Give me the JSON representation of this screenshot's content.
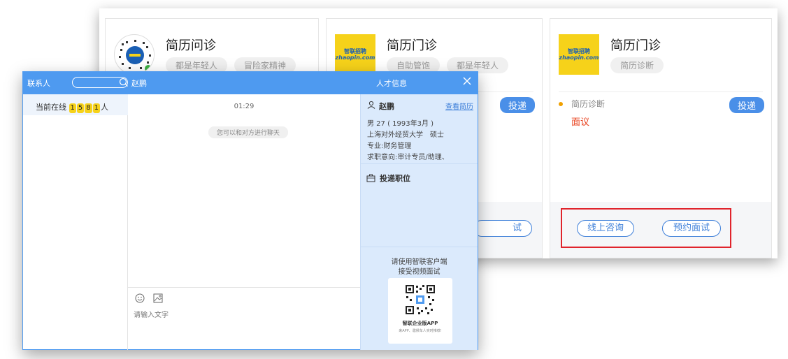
{
  "cards": [
    {
      "title": "简历问诊",
      "tags": [
        "都是年轻人",
        "冒险家精神"
      ]
    },
    {
      "title": "简历门诊",
      "tags": [
        "自助管饱",
        "都是年轻人"
      ],
      "deliver": "投递",
      "bottom_button": "试"
    },
    {
      "title": "简历门诊",
      "tags": [
        "简历诊断"
      ],
      "deliver": "投递",
      "position": "简历诊断",
      "salary": "面议",
      "buttons": {
        "consult": "线上咨询",
        "interview": "预约面试"
      }
    }
  ],
  "logo": {
    "top": "智联招聘",
    "bottom": "zhaopin.com"
  },
  "chat": {
    "contacts_label": "联系人",
    "search_placeholder": "",
    "peer_name": "赵鹏",
    "talent_info_label": "人才信息",
    "online": {
      "prefix": "当前在线",
      "digits": [
        "1",
        "5",
        "8",
        "1"
      ],
      "suffix": "人"
    },
    "message_time": "01:29",
    "chat_hint": "您可以和对方进行聊天",
    "input_placeholder": "请输入文字",
    "profile": {
      "name": "赵鹏",
      "view_resume": "查看简历",
      "line1": "男 27 ( 1993年3月 )",
      "line2": "上海对外经贸大学　硕士",
      "line3": "专业:财务管理",
      "line4": "求职意向:审计专员/助理、"
    },
    "applied_positions": "投递职位",
    "video": {
      "line1": "请使用智联客户端",
      "line2": "接受视频面试",
      "app_name": "智联企业版APP",
      "app_desc": "来APP、邀候车人实时推荐!"
    }
  },
  "colors": {
    "accent": "#4e9af0",
    "highlight": "#e0242c",
    "salary": "#e8401c",
    "logo_yellow": "#f6d21a"
  }
}
